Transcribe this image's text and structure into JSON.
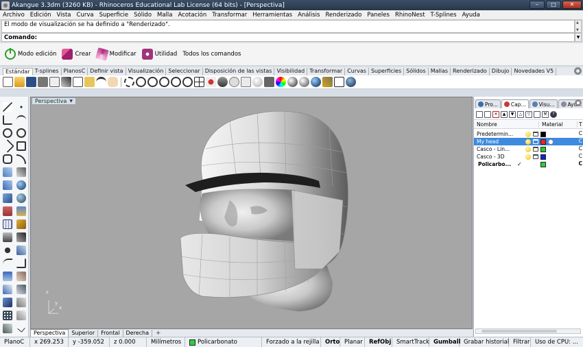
{
  "window": {
    "title": "Akangue 3.3dm (3260 KB) - Rhinoceros Educational Lab License (64 bits) - [Perspectiva]",
    "buttons": [
      "–",
      "□",
      "✕"
    ]
  },
  "menu": [
    "Archivo",
    "Edición",
    "Vista",
    "Curva",
    "Superficie",
    "Sólido",
    "Malla",
    "Acotación",
    "Transformar",
    "Herramientas",
    "Análisis",
    "Renderizado",
    "Paneles",
    "RhinoNest",
    "T-Splines",
    "Ayuda"
  ],
  "command": {
    "history": "El modo de visualización se ha definido a \"Renderizado\".",
    "prompt": "Comando:"
  },
  "tsplines_toolbar": [
    {
      "label": "Modo edición",
      "icon": "power-icon"
    },
    {
      "label": "Crear",
      "icon": "create-icon"
    },
    {
      "label": "Modificar",
      "icon": "modify-icon"
    },
    {
      "label": "Utilidad",
      "icon": "utility-icon"
    },
    {
      "label": "Todos los comandos",
      "icon": ""
    }
  ],
  "toolbar_tabs": [
    "Estándar",
    "T-splines",
    "PlanosC",
    "Definir vista",
    "Visualización",
    "Seleccionar",
    "Disposición de las vistas",
    "Visibilidad",
    "Transformar",
    "Curvas",
    "Superficies",
    "Sólidos",
    "Mallas",
    "Renderizado",
    "Dibujo",
    "Novedades V5"
  ],
  "toolbar_tab_active": "Estándar",
  "viewport": {
    "label": "Perspectiva",
    "axis_z": "z",
    "axis_y": "y",
    "axis_x": "x"
  },
  "viewport_tabs": [
    "Perspectiva",
    "Superior",
    "Frontal",
    "Derecha"
  ],
  "viewport_tab_add": "+",
  "panel": {
    "tabs": [
      {
        "label": "Pro...",
        "color": "#3a6ea5"
      },
      {
        "label": "Cap...",
        "color": "#c93a3a"
      },
      {
        "label": "Visu...",
        "color": "#5a7fae"
      },
      {
        "label": "Ayu...",
        "color": "#8a8aa0"
      }
    ],
    "columns": {
      "name": "Nombre",
      "material": "Material",
      "t": "T"
    },
    "layers": [
      {
        "name": "Predetermin...",
        "color": "#000000",
        "selected": false,
        "current": false,
        "check": ""
      },
      {
        "name": "My head",
        "color": "#ff1e1e",
        "selected": true,
        "current": false,
        "check": ""
      },
      {
        "name": "Casco - Lín...",
        "color": "#22cc22",
        "selected": false,
        "current": false,
        "check": ""
      },
      {
        "name": "Casco - 3D",
        "color": "#1122dd",
        "selected": false,
        "current": false,
        "check": ""
      },
      {
        "name": "Policarbo...",
        "color": "#28d23a",
        "selected": false,
        "current": true,
        "check": "✓"
      }
    ],
    "row_suffix": "C"
  },
  "status": {
    "cplane": "PlanoC",
    "x": "x 269.253",
    "y": "y -359.052",
    "z": "z 0.000",
    "units": "Milímetros",
    "layer": "Policarbonato",
    "layer_color": "#28d23a",
    "snap": "Forzado a la rejilla",
    "ortho": "Orto",
    "planar": "Planar",
    "refobj": "RefObj",
    "smarttrack": "SmartTrack",
    "gumball": "Gumball",
    "history": "Grabar historial",
    "filter": "Filtrar",
    "cpu": "Uso de CPU: ..."
  }
}
